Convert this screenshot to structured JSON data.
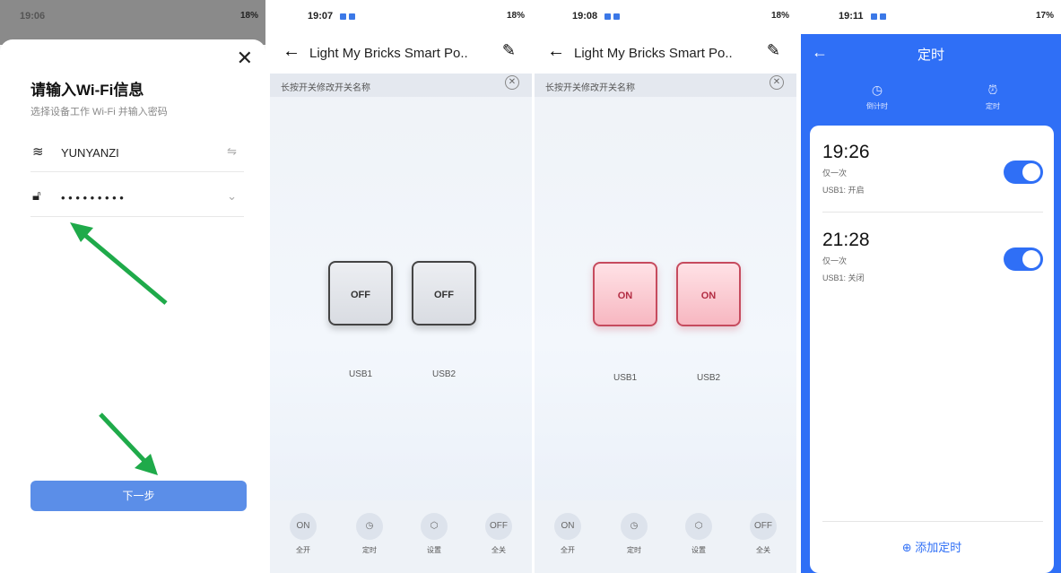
{
  "panel1": {
    "time": "19:06",
    "battery": "18%",
    "title": "请输入Wi-Fi信息",
    "subtitle": "选择设备工作 Wi-Fi 并输入密码",
    "wifi_name": "YUNYANZI",
    "password_mask": "• • • • • • • • •",
    "next_label": "下一步",
    "close_glyph": "✕"
  },
  "panel2": {
    "time": "19:07",
    "battery": "18%",
    "title": "Light My Bricks Smart Po..",
    "hint": "长按开关修改开关名称",
    "switches": [
      {
        "label": "OFF",
        "name": "USB1"
      },
      {
        "label": "OFF",
        "name": "USB2"
      }
    ],
    "bottom": [
      {
        "icon": "ON",
        "label": "全开"
      },
      {
        "icon": "◷",
        "label": "定时"
      },
      {
        "icon": "⬡",
        "label": "设置"
      },
      {
        "icon": "OFF",
        "label": "全关"
      }
    ]
  },
  "panel3": {
    "time": "19:08",
    "battery": "18%",
    "title": "Light My Bricks Smart Po..",
    "hint": "长按开关修改开关名称",
    "switches": [
      {
        "label": "ON",
        "name": "USB1"
      },
      {
        "label": "ON",
        "name": "USB2"
      }
    ],
    "bottom": [
      {
        "icon": "ON",
        "label": "全开"
      },
      {
        "icon": "◷",
        "label": "定时"
      },
      {
        "icon": "⬡",
        "label": "设置"
      },
      {
        "icon": "OFF",
        "label": "全关"
      }
    ]
  },
  "panel4": {
    "time": "19:11",
    "battery": "17%",
    "title": "定时",
    "tabs": [
      {
        "label": "倒计时"
      },
      {
        "label": "定时"
      }
    ],
    "timers": [
      {
        "time": "19:26",
        "repeat": "仅一次",
        "action": "USB1: 开启",
        "enabled": true
      },
      {
        "time": "21:28",
        "repeat": "仅一次",
        "action": "USB1: 关闭",
        "enabled": true
      }
    ],
    "add_label": "添加定时"
  },
  "colors": {
    "accent": "#2f6ff6",
    "arrow": "#1faa4a",
    "on_red": "#c64b5e"
  }
}
